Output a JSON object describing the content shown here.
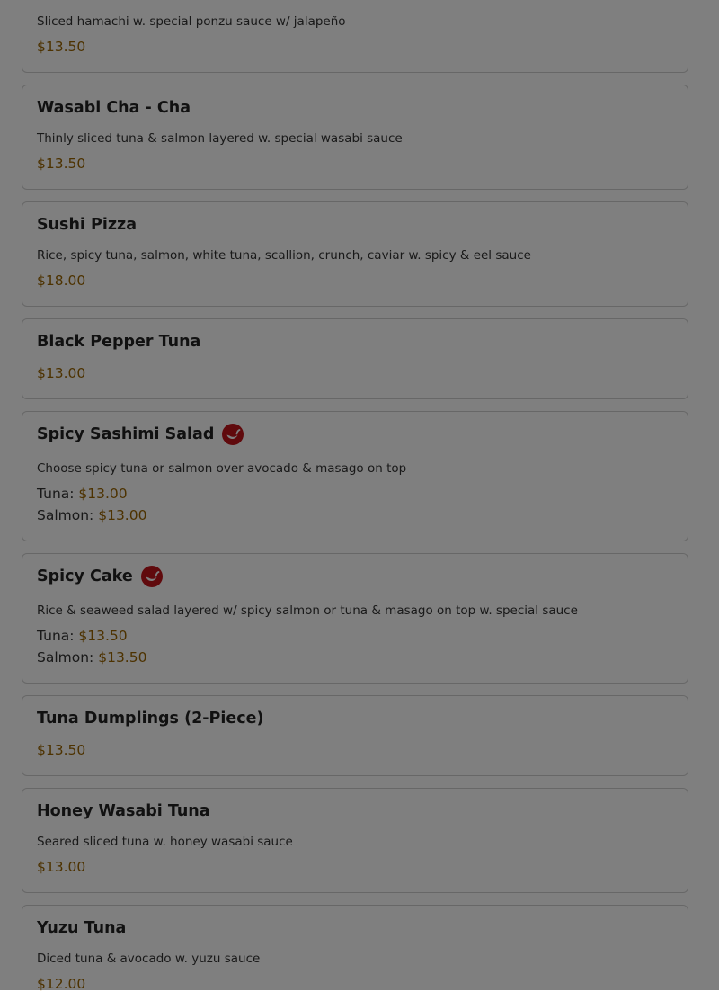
{
  "colors": {
    "price": "#9a6400",
    "spicy_icon": "#c0141b",
    "overlay": "rgba(0,0,0,0.5)"
  },
  "icons": {
    "spicy": "chili-pepper-icon"
  },
  "items": [
    {
      "description": "Sliced hamachi w. special ponzu sauce w/ jalapeño",
      "price": "$13.50"
    },
    {
      "name": "Wasabi Cha - Cha",
      "description": "Thinly sliced tuna & salmon layered w. special wasabi sauce",
      "price": "$13.50"
    },
    {
      "name": "Sushi Pizza",
      "description": "Rice, spicy tuna, salmon, white tuna, scallion, crunch, caviar w. spicy & eel sauce",
      "price": "$18.00"
    },
    {
      "name": "Black Pepper Tuna",
      "price": "$13.00"
    },
    {
      "name": "Spicy Sashimi Salad",
      "spicy": true,
      "description": "Choose spicy tuna or salmon over avocado & masago on top",
      "options": [
        {
          "label": "Tuna:",
          "price": "$13.00"
        },
        {
          "label": "Salmon:",
          "price": "$13.00"
        }
      ]
    },
    {
      "name": "Spicy Cake",
      "spicy": true,
      "description": "Rice & seaweed salad layered w/ spicy salmon or tuna & masago on top w. special sauce",
      "options": [
        {
          "label": "Tuna:",
          "price": "$13.50"
        },
        {
          "label": "Salmon:",
          "price": "$13.50"
        }
      ]
    },
    {
      "name": "Tuna Dumplings (2-Piece)",
      "price": "$13.50"
    },
    {
      "name": "Honey Wasabi Tuna",
      "description": "Seared sliced tuna w. honey wasabi sauce",
      "price": "$13.00"
    },
    {
      "name": "Yuzu Tuna",
      "description": "Diced tuna & avocado w. yuzu sauce",
      "price": "$12.00"
    }
  ]
}
